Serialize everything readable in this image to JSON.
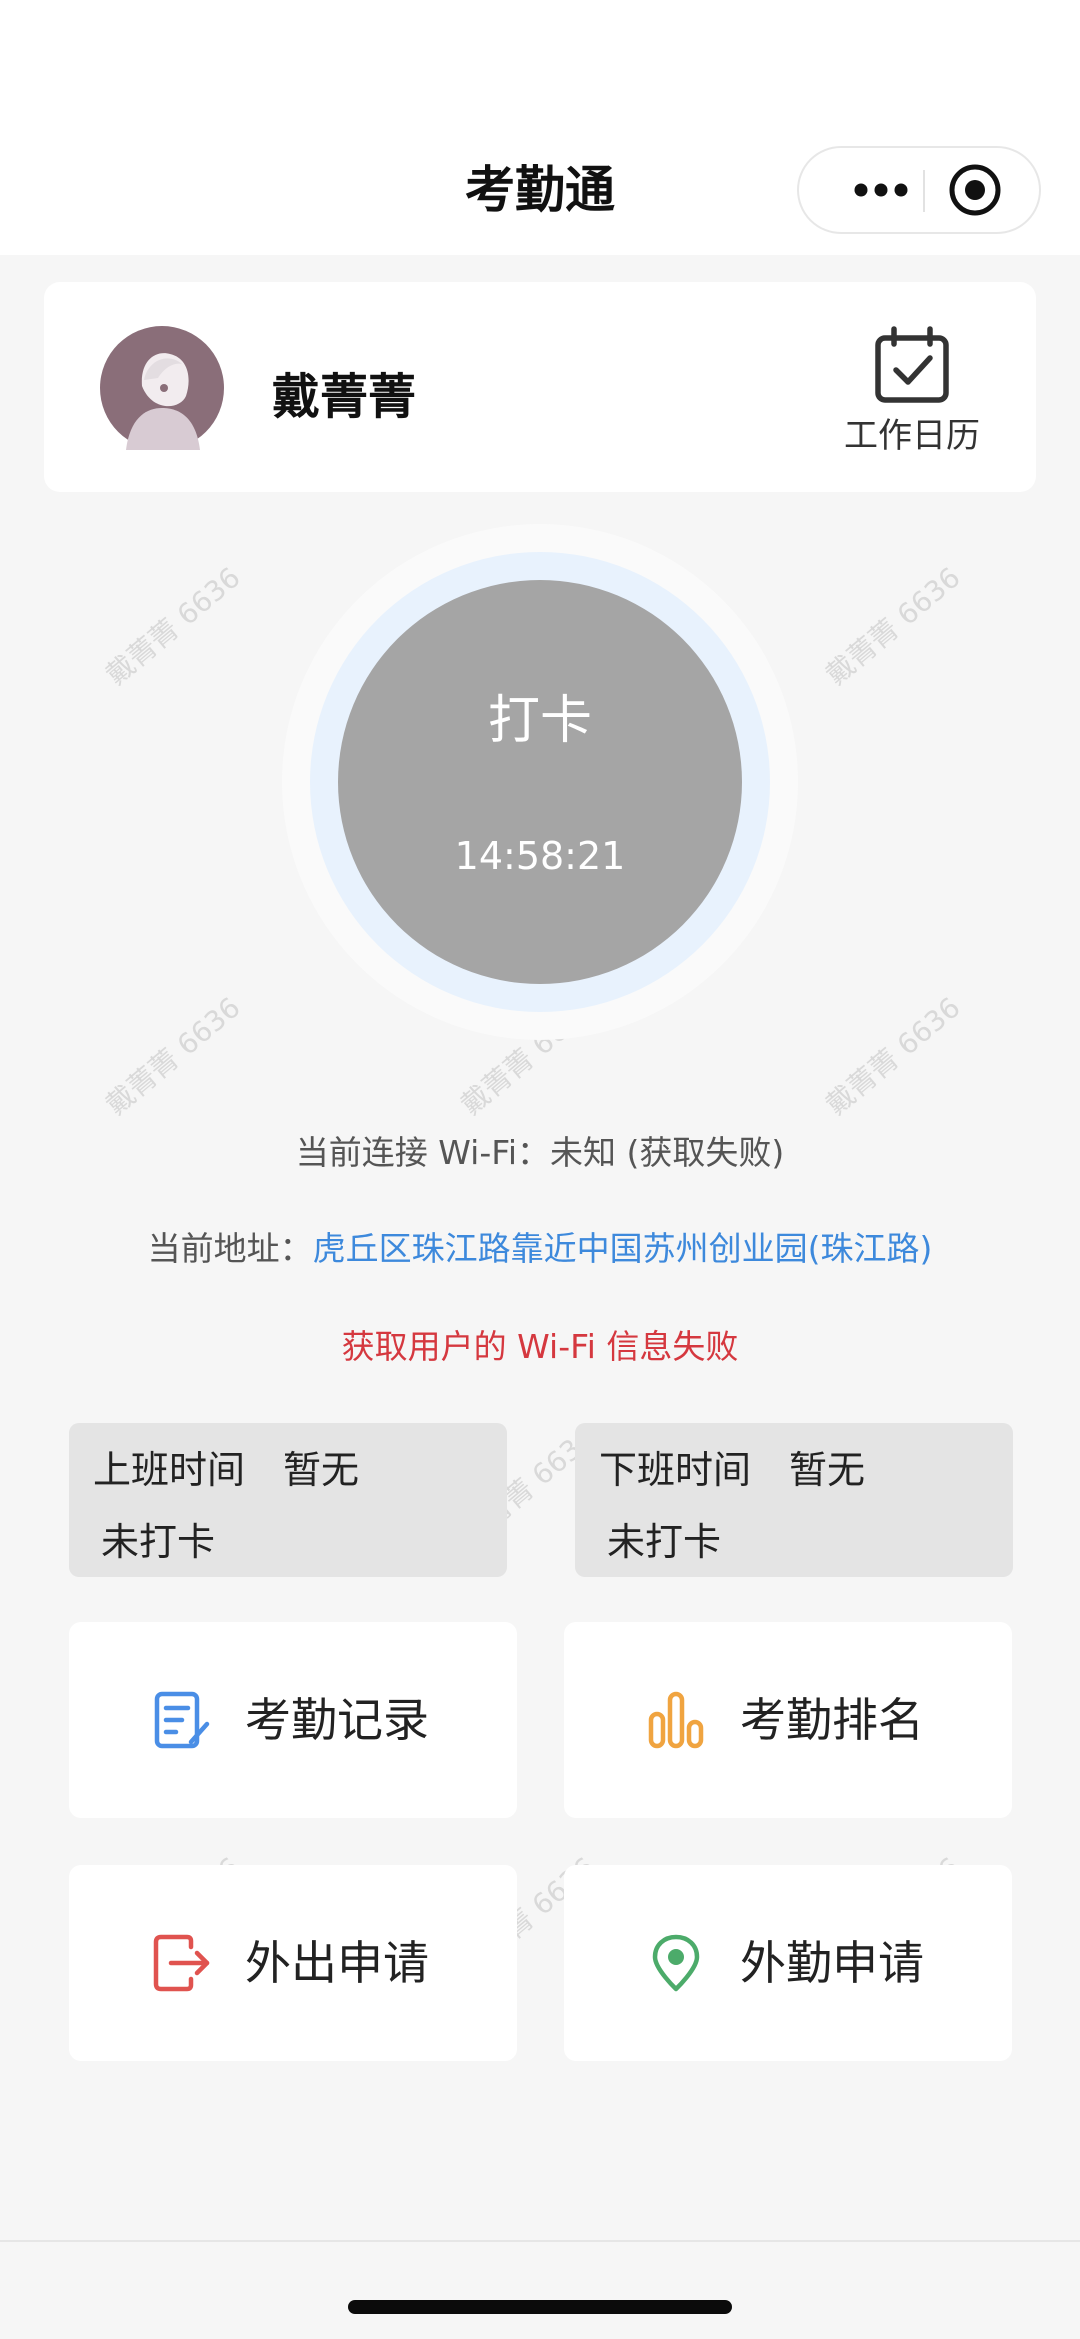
{
  "nav": {
    "title": "考勤通"
  },
  "watermark": {
    "text": "戴菁菁 6636"
  },
  "user": {
    "name": "戴菁菁"
  },
  "calendar": {
    "label": "工作日历"
  },
  "punch": {
    "label": "打卡",
    "time": "14:58:21"
  },
  "wifi": {
    "text": "当前连接 Wi-Fi：未知 (获取失败)"
  },
  "address": {
    "prefix": "当前地址：",
    "value": "虎丘区珠江路靠近中国苏州创业园(珠江路)"
  },
  "error": {
    "text": "获取用户的 Wi-Fi 信息失败"
  },
  "clock_in": {
    "label": "上班时间",
    "value": "暂无",
    "status": "未打卡"
  },
  "clock_out": {
    "label": "下班时间",
    "value": "暂无",
    "status": "未打卡"
  },
  "actions": [
    {
      "label": "考勤记录",
      "icon": "attendance-record-icon",
      "color": "#4a8ee6"
    },
    {
      "label": "考勤排名",
      "icon": "ranking-chart-icon",
      "color": "#f0a440"
    },
    {
      "label": "外出申请",
      "icon": "exit-door-icon",
      "color": "#e0534f"
    },
    {
      "label": "外勤申请",
      "icon": "location-pin-icon",
      "color": "#4cab6a"
    }
  ],
  "colors": {
    "link": "#3d89dc",
    "error": "#d5383f",
    "punch_button": "#a5a5a5",
    "punch_ring": "#e8f2fd"
  }
}
